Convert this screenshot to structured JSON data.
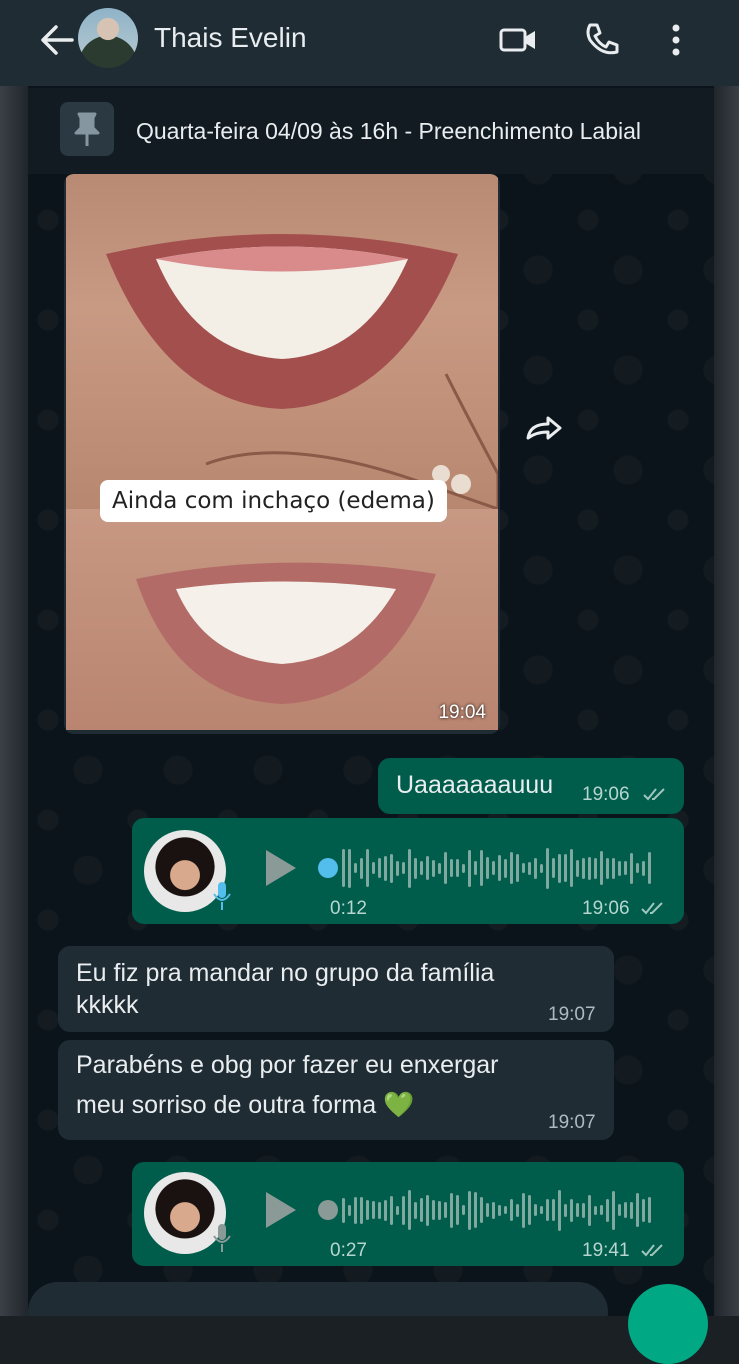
{
  "header": {
    "contact_name": "Thais Evelin",
    "icons": [
      "back-arrow-icon",
      "video-call-icon",
      "phone-icon",
      "more-vert-icon"
    ]
  },
  "pinned": {
    "text": "Quarta-feira 04/09 às 16h - Preenchimento Labial",
    "icon": "pin-icon"
  },
  "messages": [
    {
      "type": "image",
      "direction": "in",
      "caption": "Ainda com inchaço (edema)",
      "time": "19:04"
    },
    {
      "type": "text",
      "direction": "out",
      "text": "Uaaaaaaauuu",
      "time": "19:06",
      "read": true
    },
    {
      "type": "voice",
      "direction": "out",
      "duration": "0:12",
      "time": "19:06",
      "read": true,
      "played": false
    },
    {
      "type": "text",
      "direction": "in",
      "text_line1": "Eu fiz pra mandar no grupo da família",
      "text_line2": "kkkkk",
      "time": "19:07"
    },
    {
      "type": "text",
      "direction": "in",
      "text_line1": "Parabéns e obg por fazer eu enxergar",
      "text_line2": "meu sorriso de outra forma 💚",
      "time": "19:07"
    },
    {
      "type": "voice",
      "direction": "out",
      "duration": "0:27",
      "time": "19:41",
      "read": true,
      "played": true
    }
  ],
  "colors": {
    "outgoing_bubble": "#005c4b",
    "incoming_bubble": "#1f2c34",
    "tick_read": "#53bdeb",
    "accent": "#00a884"
  }
}
